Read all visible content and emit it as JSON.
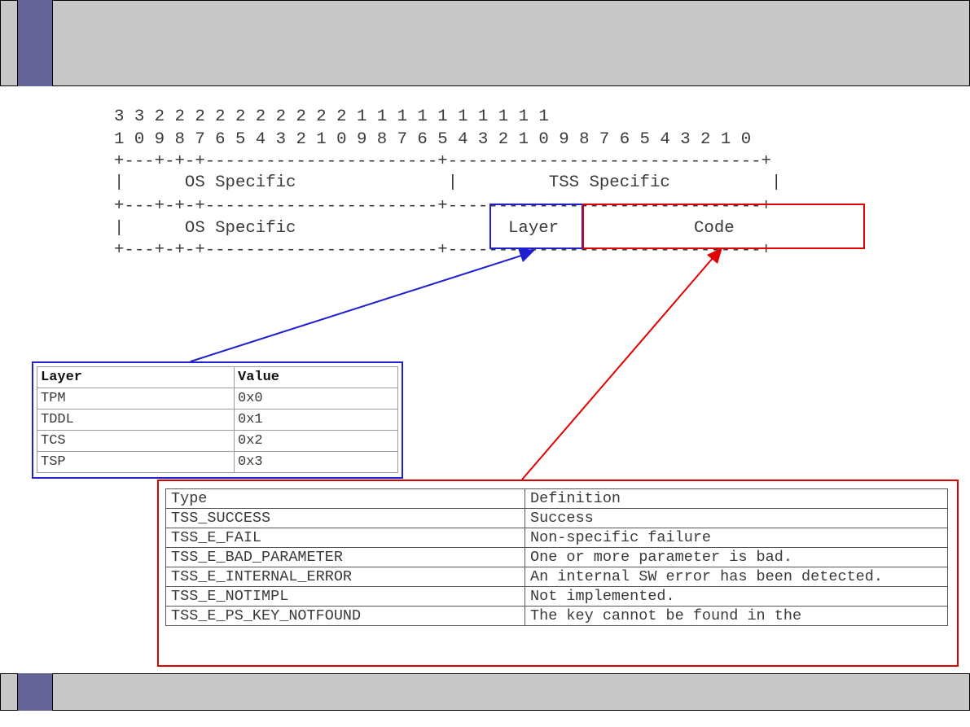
{
  "bitfield": {
    "bit_tens": "3 3 2 2 2 2 2 2 2 2 2 2 1 1 1 1 1 1 1 1 1 1",
    "bit_ones": "1 0 9 8 7 6 5 4 3 2 1 0 9 8 7 6 5 4 3 2 1 0 9 8 7 6 5 4 3 2 1 0",
    "rule_top": "+---+-+-+-----------------------+-------------------------------+",
    "row1": "|      OS Specific               |         TSS Specific          |",
    "rule_mid": "+---+-+-+-----------------------+-------------------------------+",
    "row2_left": "|      OS Specific",
    "layer_label": "Layer",
    "code_label": "Code",
    "rule_bottom": "+---+-+-+-----------------------+-------------------------------+"
  },
  "colors": {
    "layer_accent": "#1f1fd0",
    "code_accent": "#e00000",
    "bar_accent": "#636396"
  },
  "layer_table": {
    "headers": [
      "Layer",
      "Value"
    ],
    "rows": [
      [
        "TPM",
        "0x0"
      ],
      [
        "TDDL",
        "0x1"
      ],
      [
        "TCS",
        "0x2"
      ],
      [
        "TSP",
        "0x3"
      ]
    ]
  },
  "code_table": {
    "headers": [
      "Type",
      "Definition"
    ],
    "rows": [
      [
        "TSS_SUCCESS",
        "Success"
      ],
      [
        "TSS_E_FAIL",
        "Non-specific failure"
      ],
      [
        "TSS_E_BAD_PARAMETER",
        "One or more parameter is bad."
      ],
      [
        "TSS_E_INTERNAL_ERROR",
        "An internal SW error has been detected."
      ],
      [
        "TSS_E_NOTIMPL",
        "Not implemented."
      ],
      [
        "TSS_E_PS_KEY_NOTFOUND",
        "The key cannot be found in the"
      ]
    ]
  }
}
